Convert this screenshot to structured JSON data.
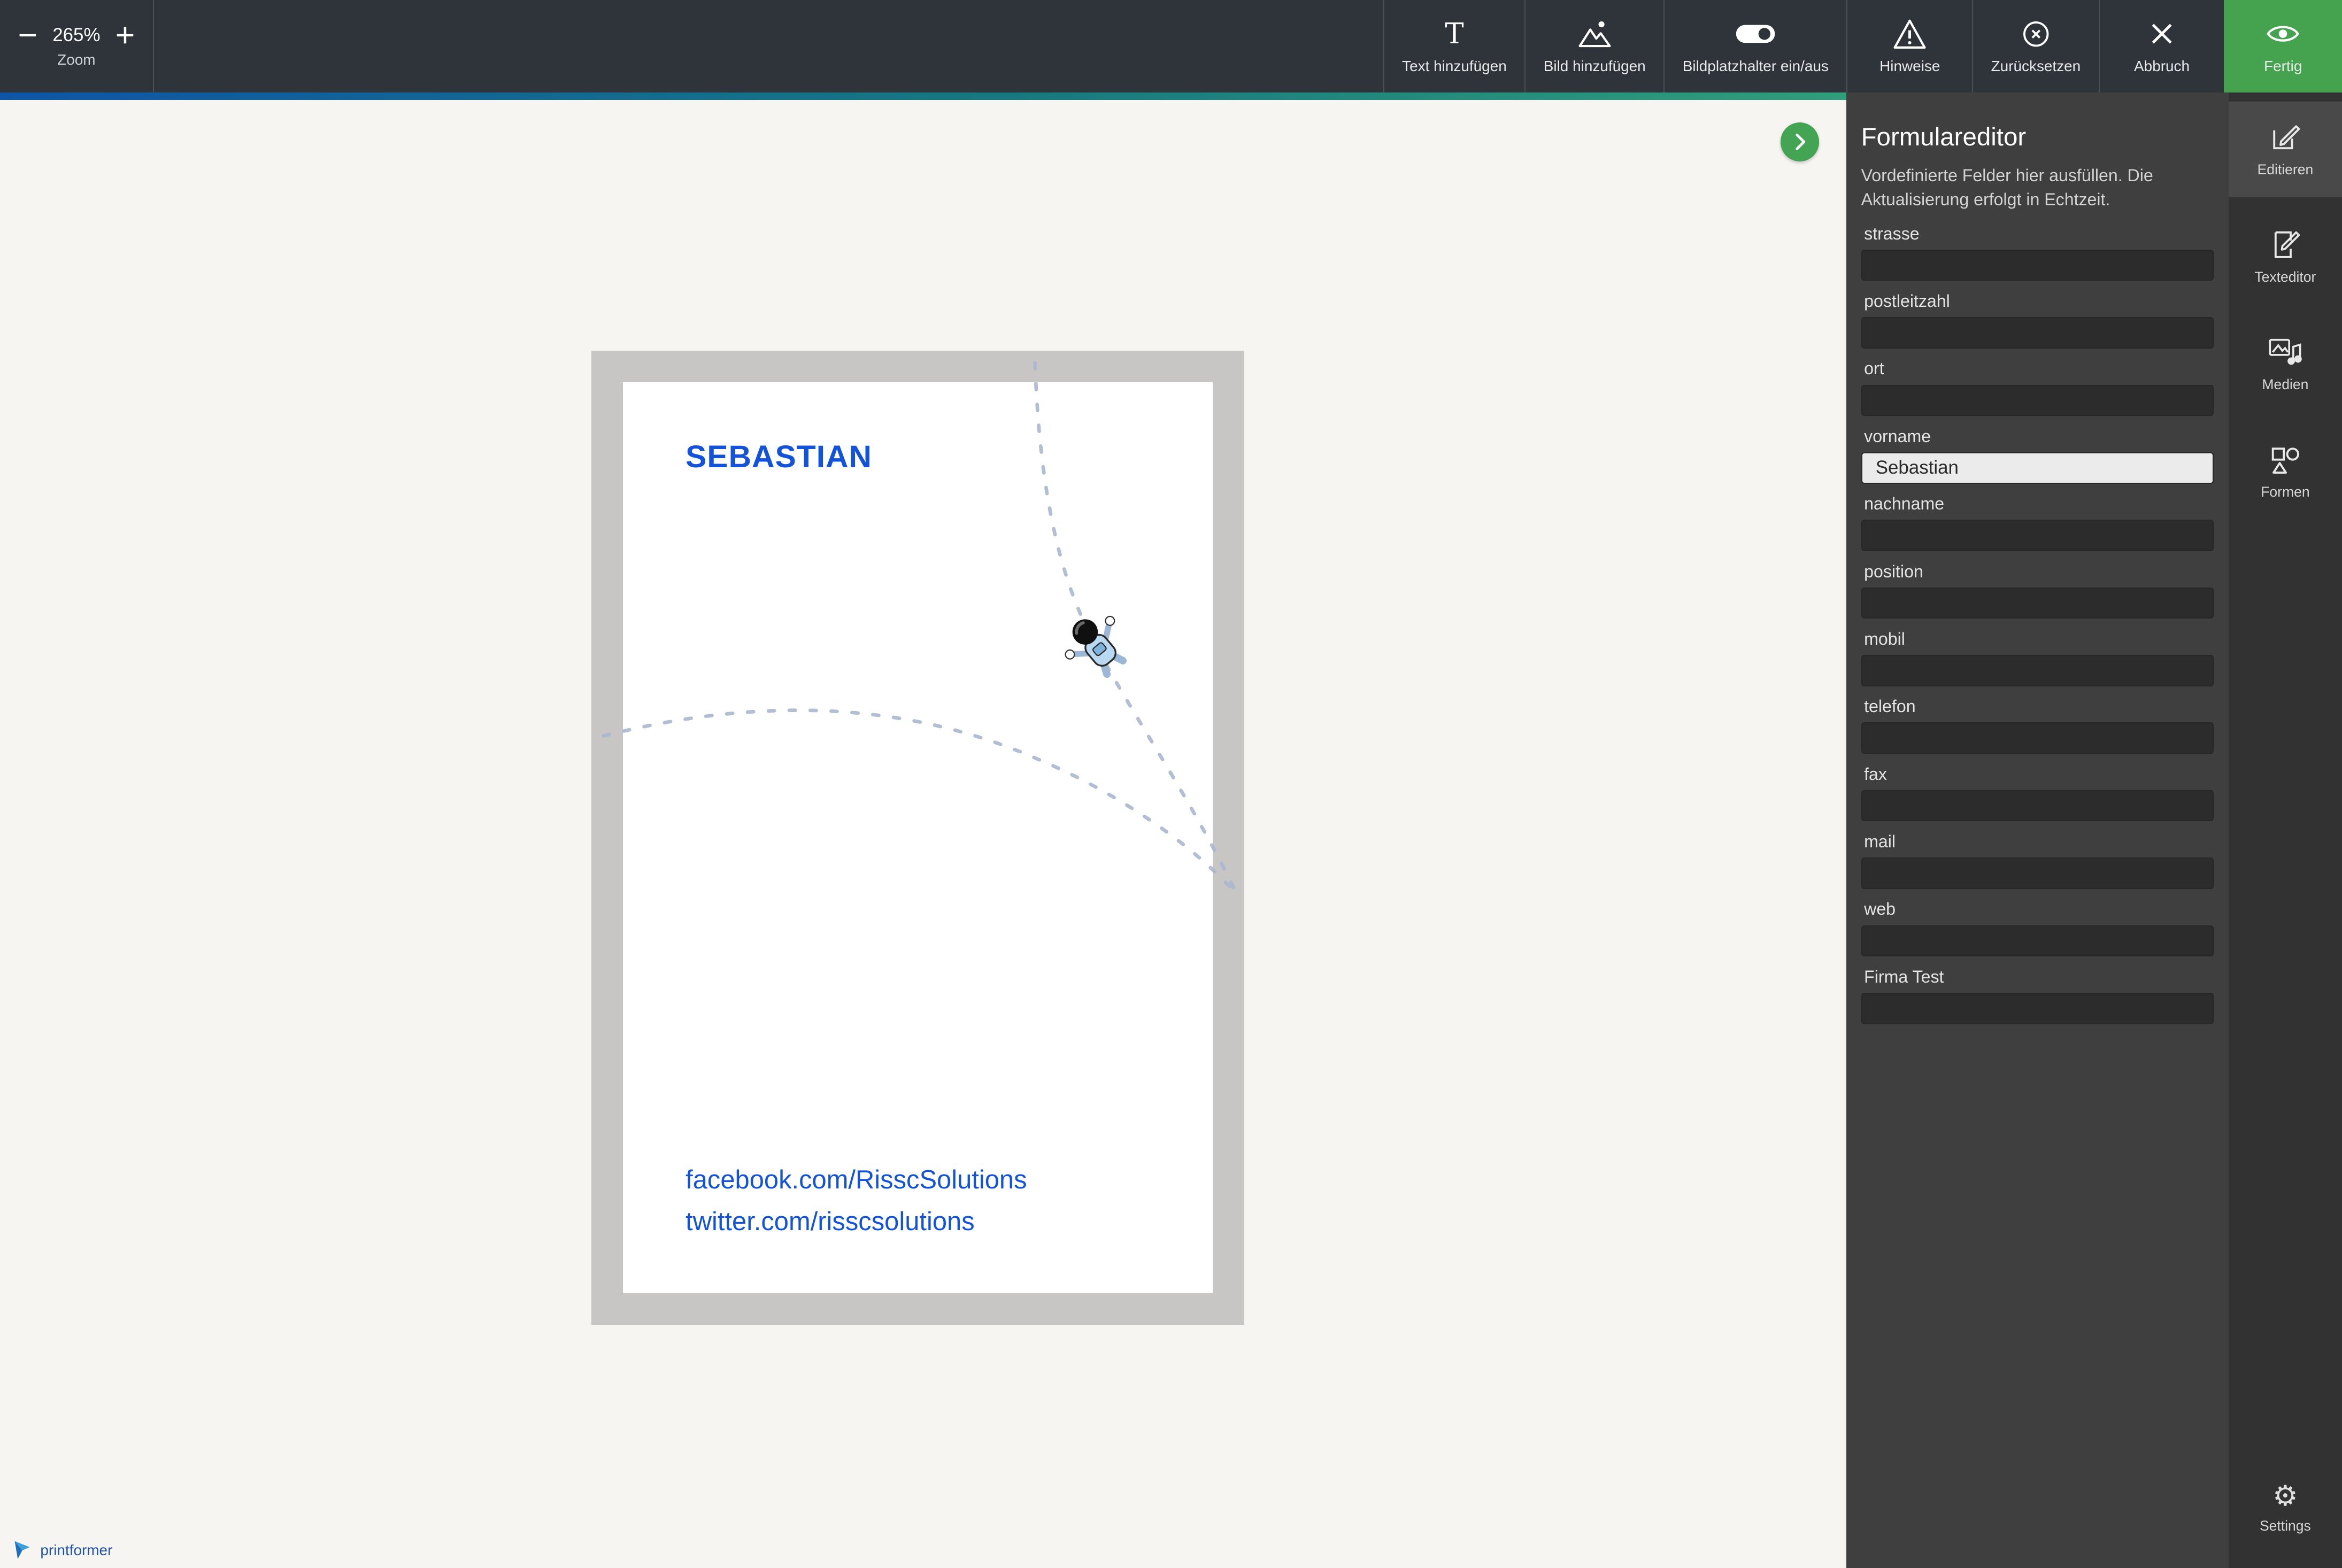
{
  "toolbar": {
    "zoom": {
      "value": "265%",
      "label": "Zoom"
    },
    "buttons": [
      {
        "label": "Text hinzufügen"
      },
      {
        "label": "Bild hinzufügen"
      },
      {
        "label": "Bildplatzhalter ein/aus"
      },
      {
        "label": "Hinweise"
      },
      {
        "label": "Zurücksetzen"
      },
      {
        "label": "Abbruch"
      },
      {
        "label": "Fertig"
      }
    ]
  },
  "icons": {
    "text_add_glyph": "T",
    "settings_glyph": "⚙"
  },
  "canvas": {
    "card": {
      "name": "SEBASTIAN",
      "facebook": "facebook.com/RisscSolutions",
      "twitter": "twitter.com/risscsolutions"
    }
  },
  "form_panel": {
    "title": "Formulareditor",
    "subtitle": "Vordefinierte Felder hier ausfüllen. Die Aktualisierung erfolgt in Echtzeit.",
    "fields": [
      {
        "label": "strasse",
        "value": ""
      },
      {
        "label": "postleitzahl",
        "value": ""
      },
      {
        "label": "ort",
        "value": ""
      },
      {
        "label": "vorname",
        "value": "Sebastian"
      },
      {
        "label": "nachname",
        "value": ""
      },
      {
        "label": "position",
        "value": ""
      },
      {
        "label": "mobil",
        "value": ""
      },
      {
        "label": "telefon",
        "value": ""
      },
      {
        "label": "fax",
        "value": ""
      },
      {
        "label": "mail",
        "value": ""
      },
      {
        "label": "web",
        "value": ""
      },
      {
        "label": "Firma Test",
        "value": ""
      }
    ]
  },
  "sidebar": {
    "items": [
      {
        "label": "Editieren"
      },
      {
        "label": "Texteditor"
      },
      {
        "label": "Medien"
      },
      {
        "label": "Formen"
      }
    ],
    "settings_label": "Settings"
  },
  "footer": {
    "brand": "printformer"
  },
  "colors": {
    "accent_green": "#45a24f",
    "gradient_start": "#0e55a7",
    "gradient_end": "#2f9e7a",
    "card_text_blue": "#1353d9",
    "panel_bg": "#3f3f3f",
    "toolbar_bg": "#2f343a"
  }
}
